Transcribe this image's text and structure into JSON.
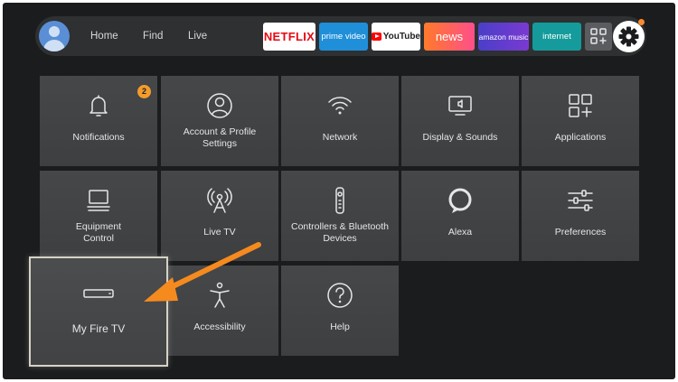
{
  "nav": {
    "home": "Home",
    "find": "Find",
    "live": "Live"
  },
  "apps": {
    "netflix": "NETFLIX",
    "prime": "prime video",
    "youtube": "YouTube",
    "news": "news",
    "amazon_music": "amazon music",
    "internet": "internet"
  },
  "notifications_badge": "2",
  "tiles": {
    "notifications": "Notifications",
    "account_profile": [
      "Account & Profile",
      "Settings"
    ],
    "network": "Network",
    "display_sounds": "Display & Sounds",
    "applications": "Applications",
    "equipment_control": [
      "Equipment",
      "Control"
    ],
    "live_tv": "Live TV",
    "controllers": [
      "Controllers & Bluetooth",
      "Devices"
    ],
    "alexa": "Alexa",
    "preferences": "Preferences",
    "my_fire_tv": "My Fire TV",
    "accessibility": "Accessibility",
    "help": "Help"
  },
  "colors": {
    "accent_orange": "#f58a1f",
    "badge": "#f39c2b",
    "tile_bg": "#454749"
  },
  "icons": [
    "user-avatar-icon",
    "apps-grid-icon",
    "gear-icon",
    "bell-icon",
    "person-circle-icon",
    "wifi-icon",
    "display-icon",
    "apps-icon",
    "monitor-icon",
    "antenna-icon",
    "remote-icon",
    "alexa-ring-icon",
    "sliders-icon",
    "fire-tv-stick-icon",
    "accessibility-icon",
    "help-icon"
  ]
}
